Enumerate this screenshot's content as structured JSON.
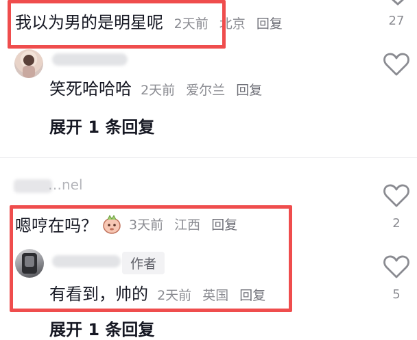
{
  "comment1": {
    "text": "我以为男的是明星呢",
    "time": "2天前",
    "location": "北京",
    "reply": "回复",
    "like_count": "27"
  },
  "reply1": {
    "text": "笑死哈哈哈",
    "time": "2天前",
    "location": "爱尔兰",
    "reply": "回复",
    "expand": "展开 1 条回复"
  },
  "comment2": {
    "username_partial": "…nel",
    "text": "嗯哼在吗？",
    "time": "3天前",
    "location": "江西",
    "reply": "回复",
    "like_count": "2"
  },
  "reply2": {
    "author_badge": "作者",
    "text": "有看到，帅的",
    "time": "2天前",
    "location": "英国",
    "reply": "回复",
    "like_count": "5"
  },
  "footer_partial": "展开 1 条回复",
  "colors": {
    "highlight": "#ef4d4d",
    "text": "#161823",
    "meta": "#8a8b91"
  }
}
